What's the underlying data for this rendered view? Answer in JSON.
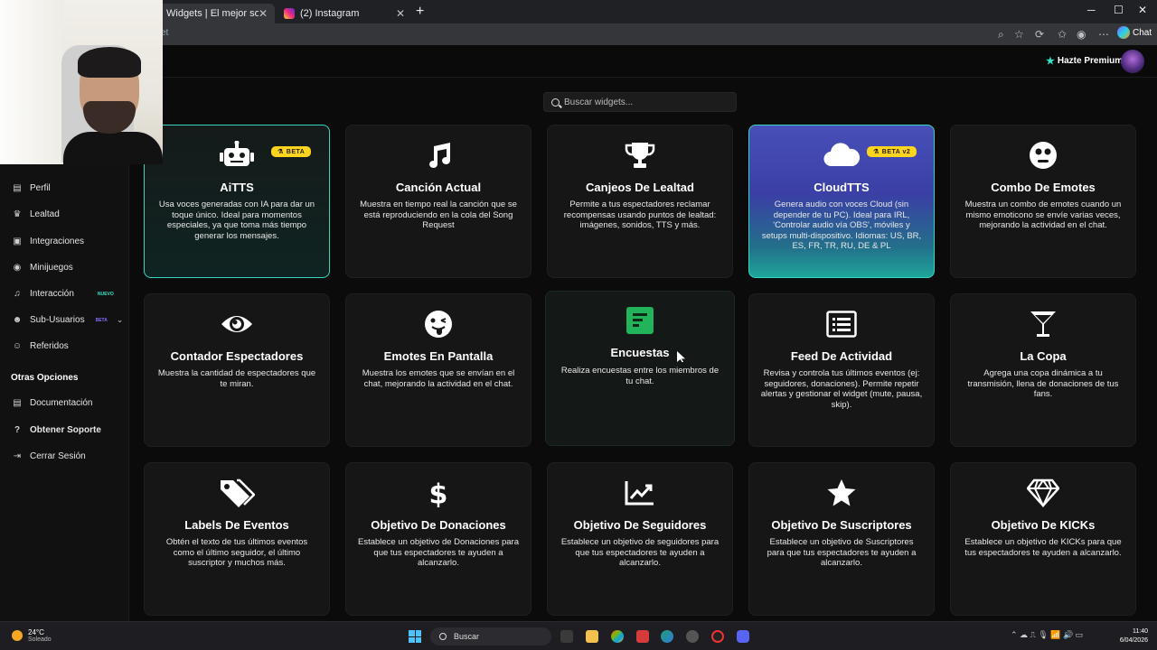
{
  "browser": {
    "tabs": [
      {
        "title": "Widgets | El mejor software para p"
      },
      {
        "title": "(2) Instagram"
      }
    ],
    "new_tab": "+",
    "address_fragment": "et",
    "chat_label": "Chat",
    "window_controls": [
      "─",
      "☐",
      "✕"
    ]
  },
  "header": {
    "premium_label": "Hazte Premium"
  },
  "sidebar": {
    "items": [
      {
        "label": "Perfil",
        "icon": "id-card-icon",
        "glyph": "▤"
      },
      {
        "label": "Lealtad",
        "icon": "trophy-icon",
        "glyph": "♛"
      },
      {
        "label": "Integraciones",
        "icon": "puzzle-icon",
        "glyph": "▣"
      },
      {
        "label": "Minijuegos",
        "icon": "gamepad-icon",
        "glyph": "◉"
      },
      {
        "label": "Interacción",
        "icon": "music-icon",
        "glyph": "♫",
        "badge": "NUEVO"
      },
      {
        "label": "Sub-Usuarios",
        "icon": "users-icon",
        "glyph": "☻",
        "badge": "BETA",
        "chevron": "⌄"
      },
      {
        "label": "Referidos",
        "icon": "user-group-icon",
        "glyph": "☺"
      }
    ],
    "section_title": "Otras Opciones",
    "other_items": [
      {
        "label": "Documentación",
        "icon": "book-icon",
        "glyph": "▤"
      },
      {
        "label": "Obtener Soporte",
        "icon": "question-circle-icon",
        "glyph": "?"
      },
      {
        "label": "Cerrar Sesión",
        "icon": "sign-out-icon",
        "glyph": "⇥"
      }
    ]
  },
  "search": {
    "placeholder": "Buscar widgets..."
  },
  "widgets": [
    {
      "title": "AiTTS",
      "icon": "robot-icon",
      "badge": "BETA",
      "desc": "Usa voces generadas con IA para dar un toque único. Ideal para momentos especiales, ya que toma más tiempo generar los mensajes."
    },
    {
      "title": "Canción Actual",
      "icon": "music-note-icon",
      "desc": "Muestra en tiempo real la canción que se está reproduciendo en la cola del Song Request"
    },
    {
      "title": "Canjeos De Lealtad",
      "icon": "trophy-icon",
      "desc": "Permite a tus espectadores reclamar recompensas usando puntos de lealtad: imágenes, sonidos, TTS y más."
    },
    {
      "title": "CloudTTS",
      "icon": "cloud-icon",
      "badge": "BETA v2",
      "desc": "Genera audio con voces Cloud (sin depender de tu PC). Ideal para IRL, 'Controlar audio vía OBS', móviles y setups multi-dispositivo. Idiomas: US, BR, ES, FR, TR, RU, DE & PL"
    },
    {
      "title": "Combo De Emotes",
      "icon": "emoji-surprise-icon",
      "desc": "Muestra un combo de emotes cuando un mismo emoticono se envíe varias veces, mejorando la actividad en el chat."
    },
    {
      "title": "Contador Espectadores",
      "icon": "eye-icon",
      "desc": "Muestra la cantidad de espectadores que te miran."
    },
    {
      "title": "Emotes En Pantalla",
      "icon": "emoji-tongue-icon",
      "desc": "Muestra los emotes que se envían en el chat, mejorando la actividad en el chat."
    },
    {
      "title": "Encuestas",
      "icon": "poll-icon",
      "desc": "Realiza encuestas entre los miembros de tu chat."
    },
    {
      "title": "Feed De Actividad",
      "icon": "list-alt-icon",
      "desc": "Revisa y controla tus últimos eventos (ej: seguidores, donaciones). Permite repetir alertas y gestionar el widget (mute, pausa, skip)."
    },
    {
      "title": "La Copa",
      "icon": "cocktail-icon",
      "desc": "Agrega una copa dinámica a tu transmisión, llena de donaciones de tus fans."
    },
    {
      "title": "Labels De Eventos",
      "icon": "tags-icon",
      "desc": "Obtén el texto de tus últimos eventos como el último seguidor, el último suscriptor y muchos más."
    },
    {
      "title": "Objetivo De Donaciones",
      "icon": "dollar-icon",
      "desc": "Establece un objetivo de Donaciones para que tus espectadores te ayuden a alcanzarlo."
    },
    {
      "title": "Objetivo De Seguidores",
      "icon": "chart-line-icon",
      "desc": "Establece un objetivo de seguidores para que tus espectadores te ayuden a alcanzarlo."
    },
    {
      "title": "Objetivo De Suscriptores",
      "icon": "star-icon",
      "desc": "Establece un objetivo de Suscriptores para que tus espectadores te ayuden a alcanzarlo."
    },
    {
      "title": "Objetivo De KICKs",
      "icon": "gem-icon",
      "desc": "Establece un objetivo de KICKs para que tus espectadores te ayuden a alcanzarlo."
    }
  ],
  "taskbar": {
    "temperature": "24°C",
    "weather": "Soleado",
    "search_label": "Buscar",
    "time": "11:40",
    "date": "6/04/2026"
  },
  "colors": {
    "accent": "#37d6c0",
    "badge": "#ffd41f",
    "poll_green": "#22b45a",
    "background": "#0b0b0b"
  }
}
